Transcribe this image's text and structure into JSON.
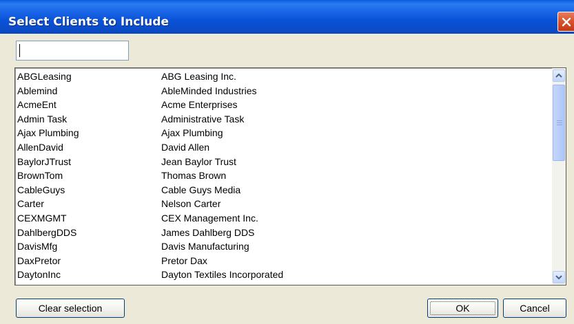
{
  "window": {
    "title": "Select Clients to Include",
    "close_icon": "close-icon"
  },
  "filter": {
    "value": "",
    "placeholder": ""
  },
  "clients": [
    {
      "code": "ABGLeasing",
      "name": "ABG Leasing Inc."
    },
    {
      "code": "Ablemind",
      "name": "AbleMinded Industries"
    },
    {
      "code": "AcmeEnt",
      "name": "Acme Enterprises"
    },
    {
      "code": "Admin Task",
      "name": "Administrative Task"
    },
    {
      "code": "Ajax Plumbing",
      "name": "Ajax Plumbing"
    },
    {
      "code": "AllenDavid",
      "name": "David Allen"
    },
    {
      "code": "BaylorJTrust",
      "name": "Jean Baylor Trust"
    },
    {
      "code": "BrownTom",
      "name": "Thomas Brown"
    },
    {
      "code": "CableGuys",
      "name": "Cable Guys Media"
    },
    {
      "code": "Carter",
      "name": "Nelson Carter"
    },
    {
      "code": "CEXMGMT",
      "name": "CEX Management Inc."
    },
    {
      "code": "DahlbergDDS",
      "name": "James Dahlberg DDS"
    },
    {
      "code": "DavisMfg",
      "name": "Davis Manufacturing"
    },
    {
      "code": "DaxPretor",
      "name": "Pretor Dax"
    },
    {
      "code": "DaytonInc",
      "name": "Dayton Textiles Incorporated"
    }
  ],
  "buttons": {
    "clear": "Clear selection",
    "ok": "OK",
    "cancel": "Cancel"
  },
  "colors": {
    "titlebar": "#0A53D8",
    "close": "#D7512B",
    "dialog_bg": "#ECE9D8"
  }
}
